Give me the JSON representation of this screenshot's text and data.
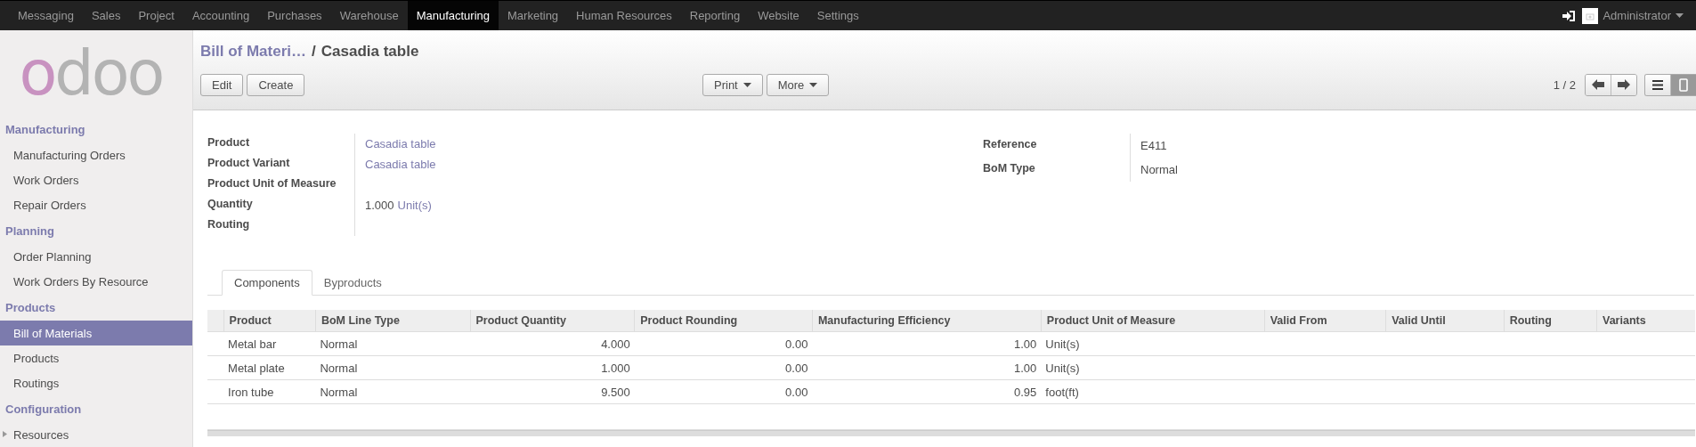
{
  "top_menu": [
    {
      "label": "Messaging",
      "selected": false
    },
    {
      "label": "Sales",
      "selected": false
    },
    {
      "label": "Project",
      "selected": false
    },
    {
      "label": "Accounting",
      "selected": false
    },
    {
      "label": "Purchases",
      "selected": false
    },
    {
      "label": "Warehouse",
      "selected": false
    },
    {
      "label": "Manufacturing",
      "selected": true
    },
    {
      "label": "Marketing",
      "selected": false
    },
    {
      "label": "Human Resources",
      "selected": false
    },
    {
      "label": "Reporting",
      "selected": false
    },
    {
      "label": "Website",
      "selected": false
    },
    {
      "label": "Settings",
      "selected": false
    }
  ],
  "user": {
    "name": "Administrator"
  },
  "logo": "odoo",
  "sidebar": {
    "sections": [
      {
        "title": "Manufacturing",
        "items": [
          {
            "label": "Manufacturing Orders",
            "selected": false
          },
          {
            "label": "Work Orders",
            "selected": false
          },
          {
            "label": "Repair Orders",
            "selected": false
          }
        ]
      },
      {
        "title": "Planning",
        "items": [
          {
            "label": "Order Planning",
            "selected": false
          },
          {
            "label": "Work Orders By Resource",
            "selected": false
          }
        ]
      },
      {
        "title": "Products",
        "items": [
          {
            "label": "Bill of Materials",
            "selected": true
          },
          {
            "label": "Products",
            "selected": false
          },
          {
            "label": "Routings",
            "selected": false
          }
        ]
      },
      {
        "title": "Configuration",
        "items": [
          {
            "label": "Resources",
            "selected": false,
            "expanded": false
          }
        ]
      }
    ]
  },
  "breadcrumb": {
    "parent": "Bill of Materi…",
    "separator": "/",
    "current": "Casadia table"
  },
  "buttons": [
    "Edit",
    "Create"
  ],
  "dropdowns": [
    "Print",
    "More"
  ],
  "pager": "1 / 2",
  "view_switcher": [
    {
      "kind": "list",
      "selected": false
    },
    {
      "kind": "form",
      "selected": true
    }
  ],
  "form": {
    "left": [
      {
        "label": "Product",
        "value": [
          {
            "text": "Casadia table",
            "link": true
          }
        ]
      },
      {
        "label": "Product Variant",
        "value": [
          {
            "text": "Casadia table",
            "link": true
          }
        ]
      },
      {
        "label": "Product Unit of Measure"
      },
      {
        "label": "Quantity",
        "value": [
          {
            "text": "1.000",
            "link": false
          },
          {
            "text": "Unit(s)",
            "link": true
          }
        ]
      },
      {
        "label": "Routing"
      }
    ],
    "right": [
      {
        "label": "Reference",
        "value": [
          {
            "text": "E411",
            "link": false
          }
        ]
      },
      {
        "label": "BoM Type",
        "value": [
          {
            "text": "Normal",
            "link": false
          }
        ]
      }
    ]
  },
  "tabs": [
    {
      "label": "Components",
      "selected": true
    },
    {
      "label": "Byproducts",
      "selected": false
    }
  ],
  "table": {
    "columns": [
      {
        "label": "Product",
        "kind": "text"
      },
      {
        "label": "BoM Line Type",
        "kind": "text"
      },
      {
        "label": "Product Quantity",
        "kind": "number"
      },
      {
        "label": "Product Rounding",
        "kind": "number"
      },
      {
        "label": "Manufacturing Efficiency",
        "kind": "number"
      },
      {
        "label": "Product Unit of Measure",
        "kind": "text"
      },
      {
        "label": "Valid From",
        "kind": "text"
      },
      {
        "label": "Valid Until",
        "kind": "text"
      },
      {
        "label": "Routing",
        "kind": "text"
      },
      {
        "label": "Variants",
        "kind": "text"
      }
    ],
    "rows": [
      [
        "Metal bar",
        "Normal",
        "4.000",
        "0.00",
        "1.00",
        "Unit(s)"
      ],
      [
        "Metal plate",
        "Normal",
        "1.000",
        "0.00",
        "1.00",
        "Unit(s)"
      ],
      [
        "Iron tube",
        "Normal",
        "9.500",
        "0.00",
        "0.95",
        "foot(ft)"
      ]
    ]
  }
}
